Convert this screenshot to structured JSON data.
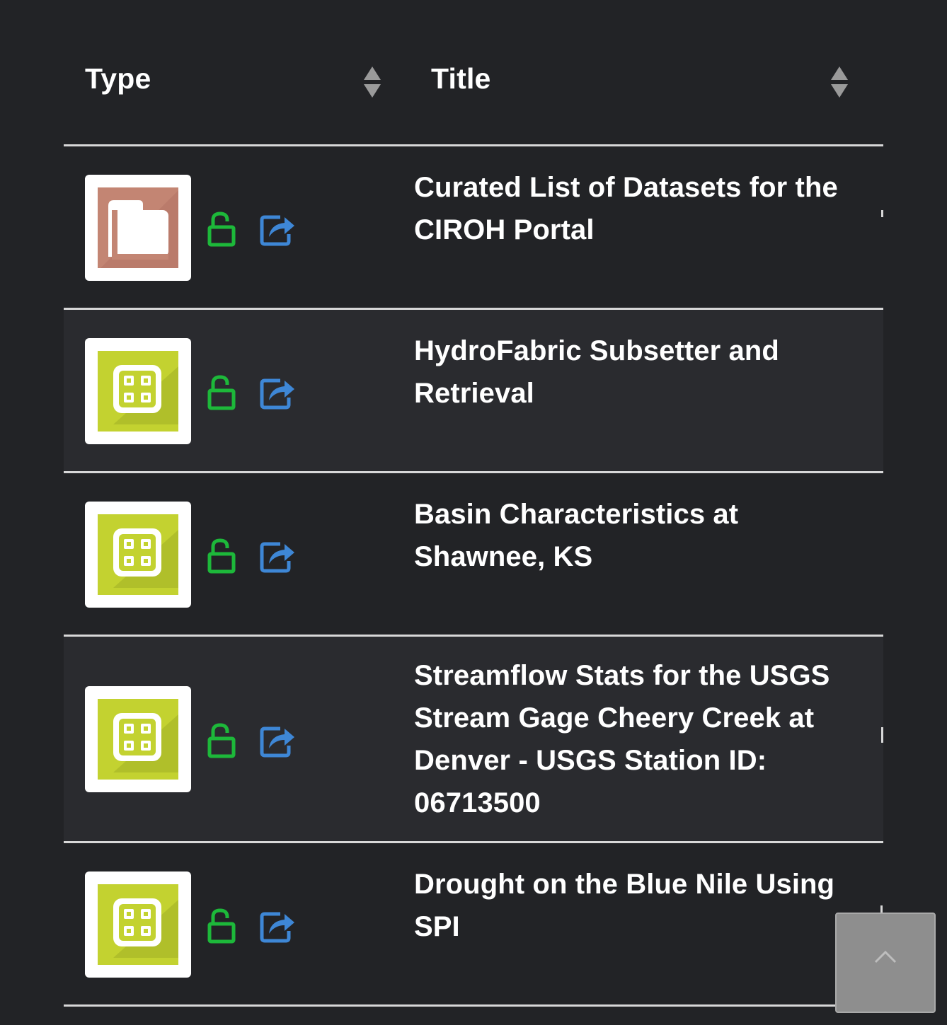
{
  "table": {
    "headers": {
      "type": "Type",
      "title": "Title"
    },
    "rows": [
      {
        "type_icon": "folder-collection-icon",
        "type_color": "#c38573",
        "access_icon": "unlock-icon",
        "access_color": "#1db83a",
        "share_icon": "share-icon",
        "share_color": "#3e87d6",
        "title_lines": [
          "Curated List of Datasets for the",
          "CIROH Portal"
        ]
      },
      {
        "type_icon": "app-grid-icon",
        "type_color": "#c3d230",
        "access_icon": "unlock-icon",
        "access_color": "#1db83a",
        "share_icon": "share-icon",
        "share_color": "#3e87d6",
        "title_lines": [
          "HydroFabric Subsetter and",
          "Retrieval"
        ]
      },
      {
        "type_icon": "app-grid-icon",
        "type_color": "#c3d230",
        "access_icon": "unlock-icon",
        "access_color": "#1db83a",
        "share_icon": "share-icon",
        "share_color": "#3e87d6",
        "title_lines": [
          "Basin Characteristics at",
          "Shawnee, KS"
        ]
      },
      {
        "type_icon": "app-grid-icon",
        "type_color": "#c3d230",
        "access_icon": "unlock-icon",
        "access_color": "#1db83a",
        "share_icon": "share-icon",
        "share_color": "#3e87d6",
        "title_lines": [
          "Streamflow Stats for the USGS",
          "Stream Gage Cheery Creek at",
          "Denver - USGS Station ID:",
          "06713500"
        ]
      },
      {
        "type_icon": "app-grid-icon",
        "type_color": "#c3d230",
        "access_icon": "unlock-icon",
        "access_color": "#1db83a",
        "share_icon": "share-icon",
        "share_color": "#3e87d6",
        "title_lines": [
          "Drought on the Blue Nile Using",
          "SPI"
        ]
      }
    ]
  },
  "back_to_top": {
    "icon": "chevron-up-icon"
  },
  "colors": {
    "background": "#222326",
    "row_alt": "#2a2b2f",
    "divider": "#d8d8d8",
    "text": "#ffffff"
  }
}
